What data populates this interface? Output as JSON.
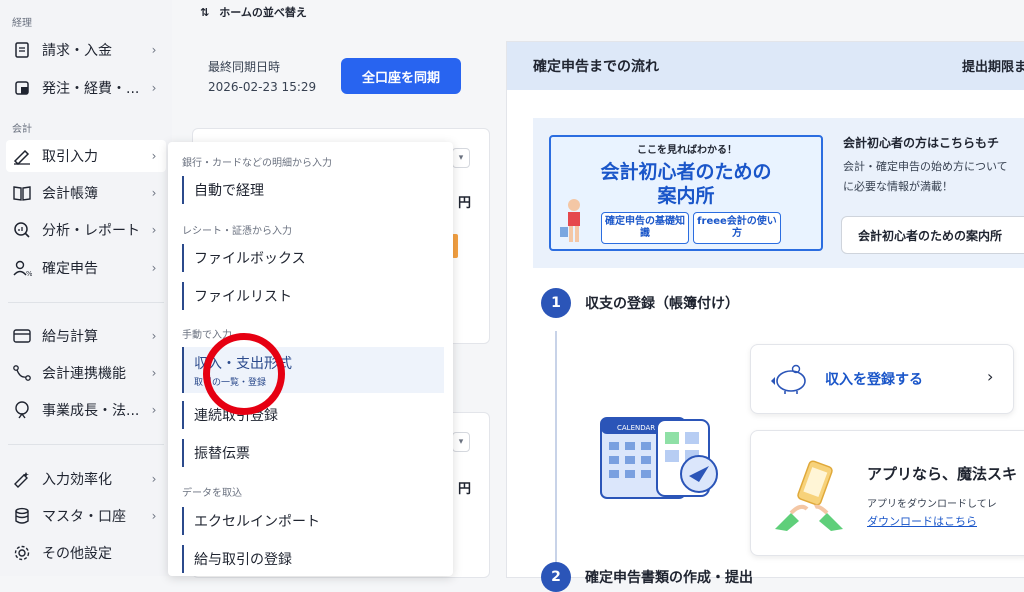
{
  "sidebar": {
    "sections": {
      "accounting": "経理",
      "bookkeeping": "会計"
    },
    "items": [
      {
        "label": "請求・入金",
        "icon": "document-icon"
      },
      {
        "label": "発注・経費・...",
        "icon": "receipt-icon"
      },
      {
        "label": "取引入力",
        "icon": "pen-icon"
      },
      {
        "label": "会計帳簿",
        "icon": "book-icon"
      },
      {
        "label": "分析・レポート",
        "icon": "analysis-icon"
      },
      {
        "label": "確定申告",
        "icon": "tax-return-icon"
      },
      {
        "label": "給与計算",
        "icon": "card-icon"
      },
      {
        "label": "会計連携機能",
        "icon": "link-icon"
      },
      {
        "label": "事業成長・法...",
        "icon": "growth-icon"
      },
      {
        "label": "入力効率化",
        "icon": "efficiency-icon"
      },
      {
        "label": "マスタ・口座",
        "icon": "database-icon"
      },
      {
        "label": "その他設定",
        "icon": "gear-icon"
      }
    ]
  },
  "header": {
    "sort_label": "ホームの並べ替え"
  },
  "sync": {
    "label": "最終同期日時",
    "datetime": "2026-02-23 15:29",
    "button": "全口座を同期"
  },
  "cards": {
    "yen1": "円",
    "yen2": "円"
  },
  "menu": {
    "categories": [
      "銀行・カードなどの明細から入力",
      "レシート・証憑から入力",
      "手動で入力",
      "データを取込"
    ],
    "items": [
      {
        "label": "自動で経理"
      },
      {
        "label": "ファイルボックス"
      },
      {
        "label": "ファイルリスト"
      },
      {
        "label": "収入・支出形式",
        "sub": "取引の一覧・登録"
      },
      {
        "label": "連続取引登録"
      },
      {
        "label": "振替伝票"
      },
      {
        "label": "エクセルインポート"
      },
      {
        "label": "給与取引の登録"
      }
    ]
  },
  "flow": {
    "title": "確定申告までの流れ",
    "deadline": "提出期限ま",
    "banner": {
      "kicker": "ここを見ればわかる！",
      "line1": "会計初心者のための",
      "line2": "案内所",
      "pill1": "確定申告の基礎知識",
      "pill2": "freee会計の使い方"
    },
    "beginner": {
      "title": "会計初心者の方はこちらもチ",
      "desc1": "会計・確定申告の始め方について",
      "desc2": "に必要な情報が満載！",
      "button": "会計初心者のための案内所"
    },
    "steps": [
      {
        "number": "1",
        "title": "収支の登録（帳簿付け）"
      },
      {
        "number": "2",
        "title": "確定申告書類の作成・提出"
      }
    ],
    "income_button": "収入を登録する",
    "app": {
      "title": "アプリなら、魔法スキ",
      "desc": "アプリをダウンロードしてレ",
      "link": "ダウンロードはこちら",
      "calendar": "CALENDAR"
    }
  },
  "colors": {
    "accent": "#2864f0",
    "highlight_ring": "#e60012",
    "flow_header": "#dde8f8"
  }
}
